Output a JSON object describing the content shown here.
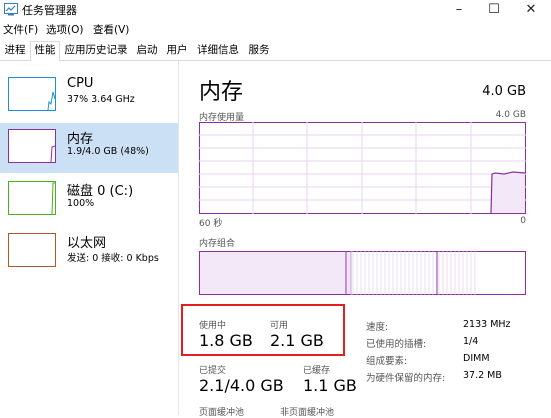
{
  "window": {
    "title": "任务管理器",
    "min": "–",
    "max": "☐",
    "close": "✕"
  },
  "menu": [
    "文件(F)",
    "选项(O)",
    "查看(V)"
  ],
  "tabs": [
    "进程",
    "性能",
    "应用历史记录",
    "启动",
    "用户",
    "详细信息",
    "服务"
  ],
  "active_tab": "性能",
  "sidebar": [
    {
      "title": "CPU",
      "subtitle": "37% 3.64 GHz",
      "color": "#1a8fd6"
    },
    {
      "title": "内存",
      "subtitle": "1.9/4.0 GB (48%)",
      "color": "#8b2ea3",
      "selected": true
    },
    {
      "title": "磁盘 0 (C:)",
      "subtitle": "100%",
      "color": "#4caf20"
    },
    {
      "title": "以太网",
      "subtitle": "发送: 0 接收: 0 Kbps",
      "color": "#a8582a"
    }
  ],
  "main": {
    "title": "内存",
    "capacity": "4.0 GB",
    "usage_label": "内存使用量",
    "usage_max": "4.0 GB",
    "time_label": "60 秒",
    "zero": "0",
    "composition_label": "内存组合",
    "in_use_label": "使用中",
    "in_use_value": "1.8 GB",
    "available_label": "可用",
    "available_value": "2.1 GB",
    "committed_label": "已提交",
    "committed_value": "2.1/4.0 GB",
    "cached_label": "已缓存",
    "cached_value": "1.1 GB",
    "paged_label": "页面缓冲池",
    "nonpaged_label": "非页面缓冲池",
    "stats": [
      {
        "label": "速度:",
        "value": "2133 MHz"
      },
      {
        "label": "已使用的插槽:",
        "value": "1/4"
      },
      {
        "label": "组成要素:",
        "value": "DIMM"
      },
      {
        "label": "为硬件保留的内存:",
        "value": "37.2 MB"
      }
    ]
  },
  "colors": {
    "accent": "#8b2ea3",
    "fill": "#f3e8f7",
    "highlight": "#e02020"
  }
}
